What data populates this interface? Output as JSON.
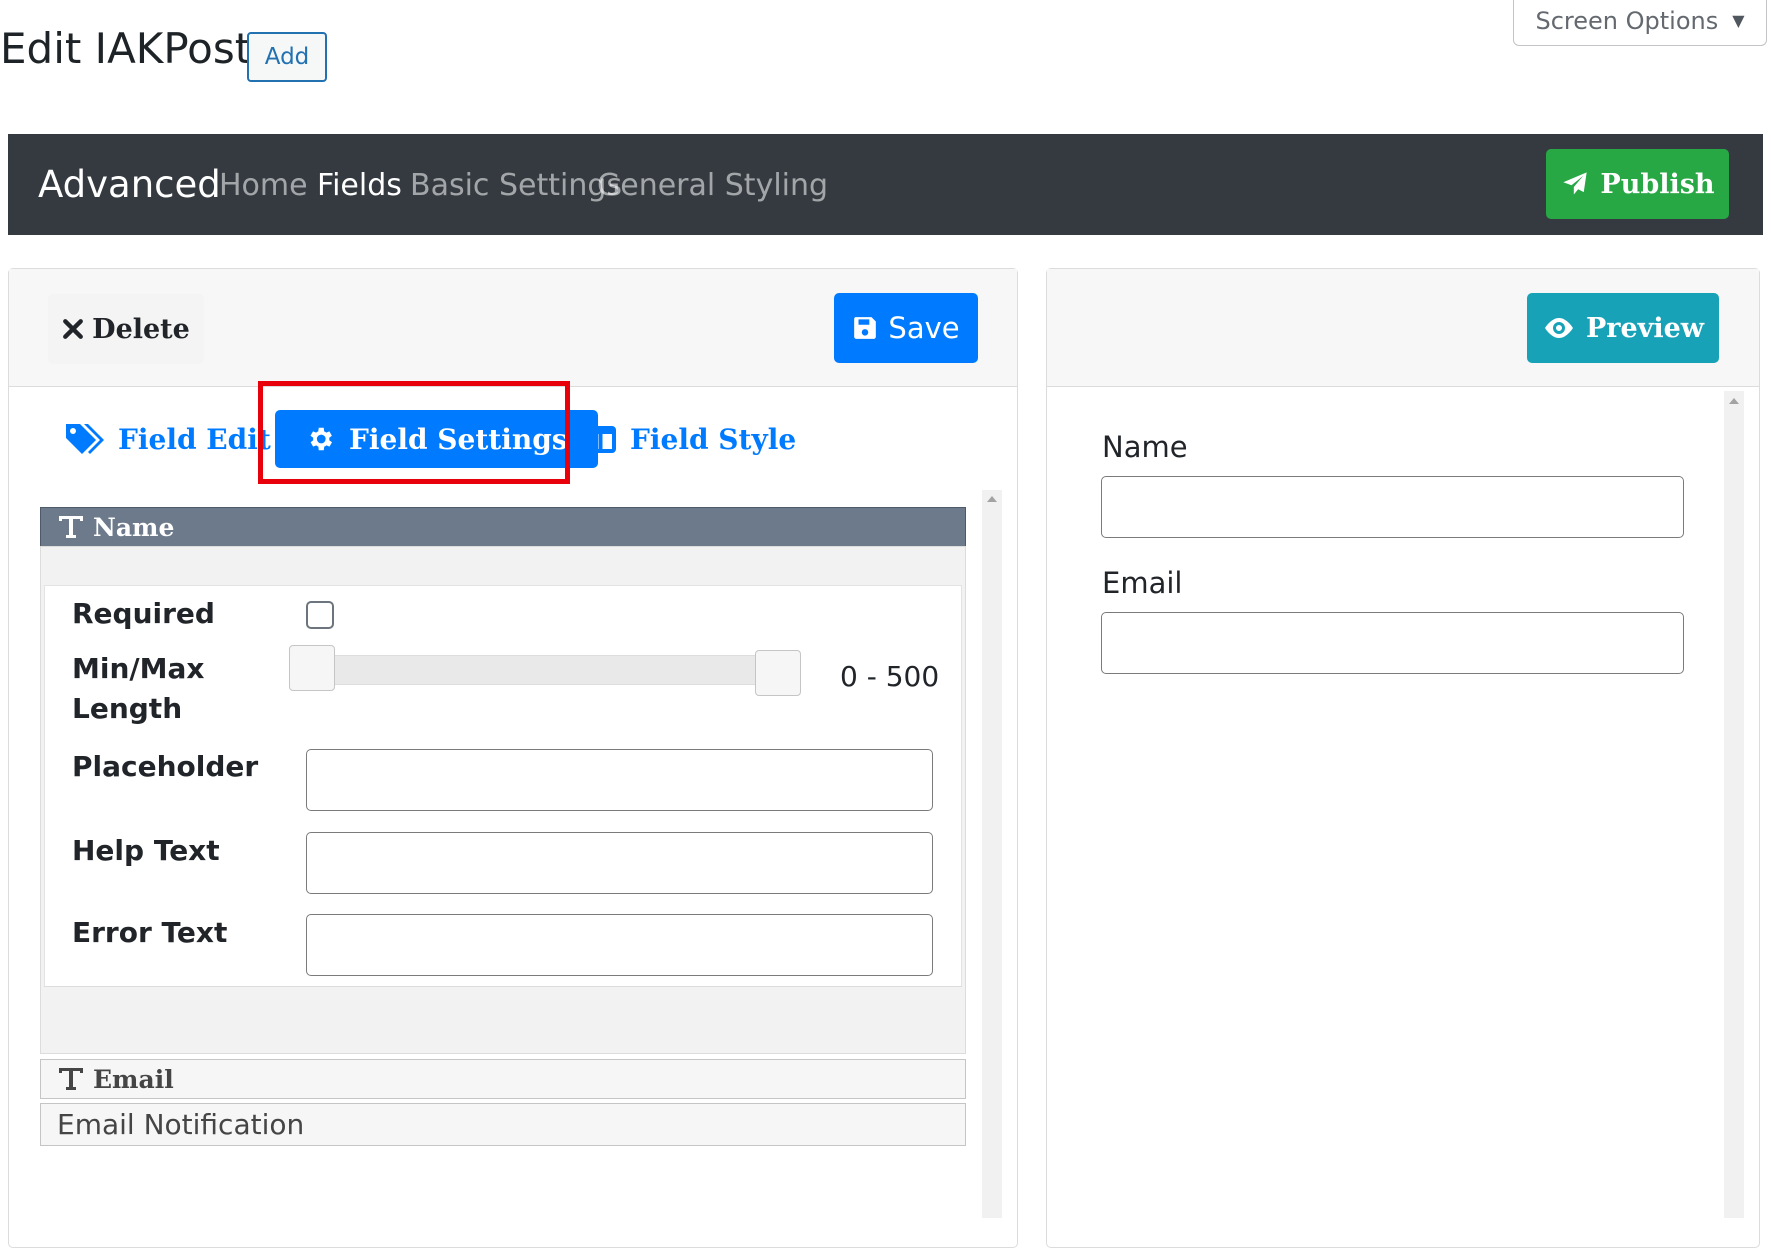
{
  "header": {
    "title": "Edit IAKPost",
    "add_label": "Add",
    "screen_options_label": "Screen Options"
  },
  "navbar": {
    "brand": "Advanced",
    "links": [
      {
        "label": "Home",
        "active": false
      },
      {
        "label": "Fields",
        "active": true
      },
      {
        "label": "Basic Settings",
        "active": false
      },
      {
        "label": "General Styling",
        "active": false
      }
    ],
    "publish_label": "Publish"
  },
  "left_panel": {
    "delete_label": "Delete",
    "save_label": "Save",
    "tabs": [
      {
        "label": "Field Edit",
        "icon": "tags-icon",
        "active": false
      },
      {
        "label": "Field Settings",
        "icon": "gear-icon",
        "active": true
      },
      {
        "label": "Field Style",
        "icon": "columns-icon",
        "active": false
      }
    ],
    "fields": [
      {
        "title": "Name",
        "expanded": true,
        "settings": {
          "required_label": "Required",
          "required_checked": false,
          "minmax_label_line1": "Min/Max",
          "minmax_label_line2": "Length",
          "range_min": 0,
          "range_max": 500,
          "range_value": "0 - 500",
          "placeholder_label": "Placeholder",
          "placeholder_value": "",
          "help_text_label": "Help Text",
          "help_text_value": "",
          "error_text_label": "Error Text",
          "error_text_value": ""
        }
      },
      {
        "title": "Email",
        "expanded": false
      }
    ],
    "notification_label": "Email Notification"
  },
  "right_panel": {
    "preview_label": "Preview",
    "form_fields": [
      {
        "label": "Name",
        "value": ""
      },
      {
        "label": "Email",
        "value": ""
      }
    ]
  },
  "colors": {
    "navbar_bg": "#343a40",
    "publish": "#28a745",
    "primary": "#007bff",
    "preview": "#17a2b8",
    "highlight": "#e8000b",
    "accordion_active": "#6c7a8c"
  }
}
